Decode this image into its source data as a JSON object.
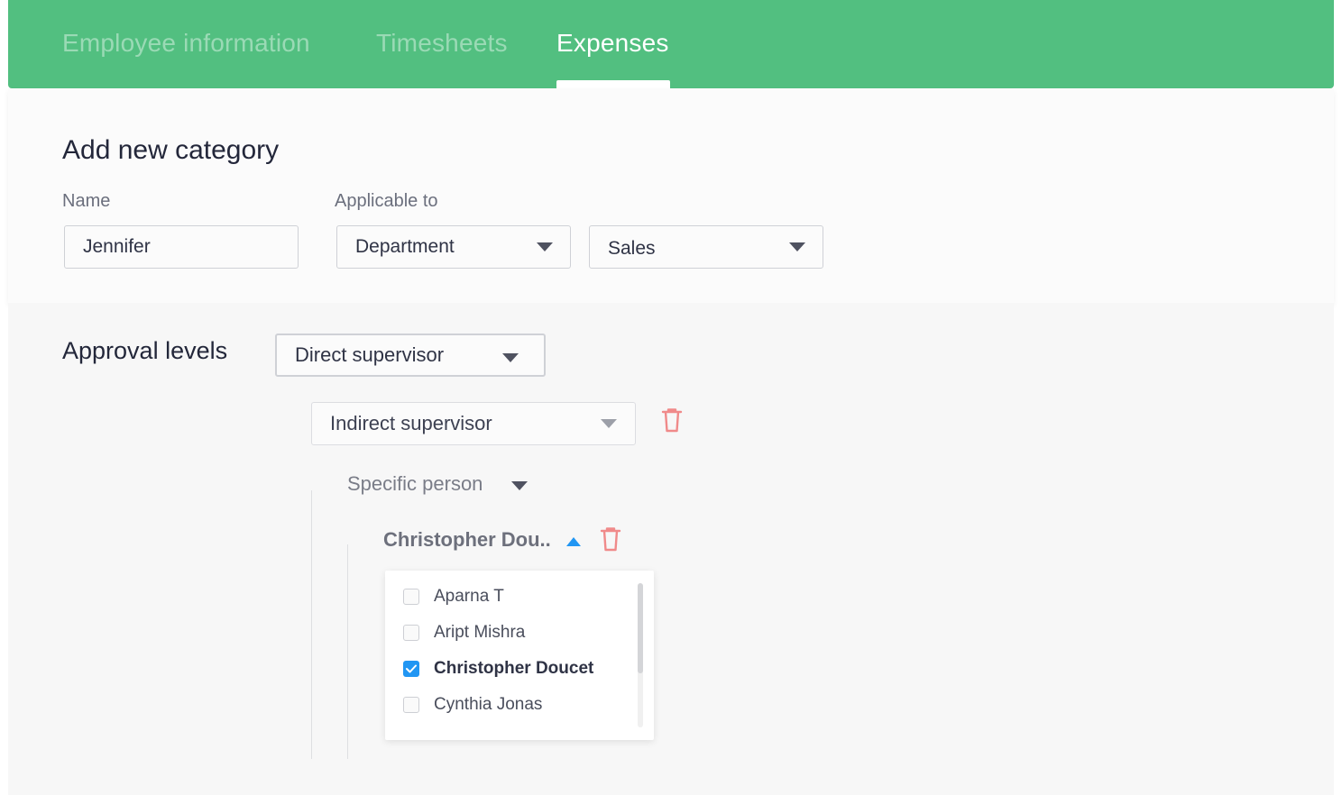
{
  "tabs": [
    {
      "label": "Employee information",
      "active": false
    },
    {
      "label": "Timesheets",
      "active": false
    },
    {
      "label": "Expenses",
      "active": true
    }
  ],
  "category": {
    "title": "Add new category",
    "name_label": "Name",
    "name_value": "Jennifer",
    "applicable_label": "Applicable to",
    "applicable_type": "Department",
    "applicable_value": "Sales"
  },
  "approval": {
    "title": "Approval levels",
    "level_1": "Direct supervisor",
    "level_2": "Indirect supervisor",
    "level_3": "Specific person",
    "selected_person": "Christopher Dou..",
    "options": [
      {
        "label": "Aparna T",
        "checked": false
      },
      {
        "label": "Aript Mishra",
        "checked": false
      },
      {
        "label": "Christopher Doucet",
        "checked": true
      },
      {
        "label": "Cynthia Jonas",
        "checked": false
      }
    ]
  },
  "colors": {
    "header_green": "#52bf80",
    "delete_red": "#f08a8a",
    "check_blue": "#2196f3"
  },
  "icons": [
    "chevron-down-icon",
    "chevron-up-icon",
    "trash-icon",
    "checkmark-icon"
  ]
}
